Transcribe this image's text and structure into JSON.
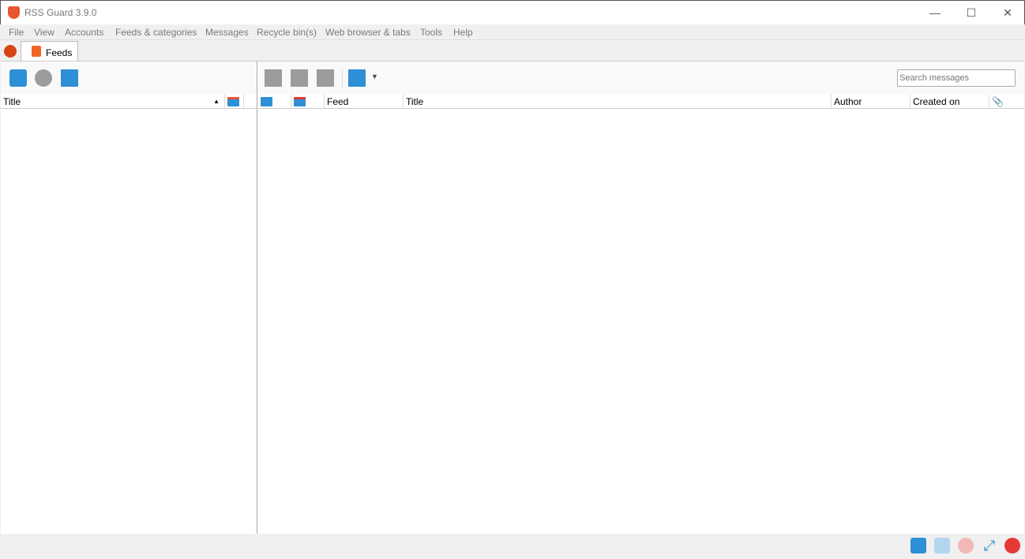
{
  "window": {
    "title": "RSS Guard 3.9.0",
    "minimize": "—",
    "maximize": "☐",
    "close": "✕"
  },
  "menu": [
    "File",
    "View",
    "Accounts",
    "Feeds & categories",
    "Messages",
    "Recycle bin(s)",
    "Web browser & tabs",
    "Tools",
    "Help"
  ],
  "tabs": [
    {
      "label": "Feeds",
      "icon": "rss-icon"
    }
  ],
  "feeds_pane": {
    "toolbar": [
      "update-feeds-icon",
      "stop-icon",
      "mark-read-icon"
    ],
    "columns": {
      "title": "Title"
    }
  },
  "messages_pane": {
    "toolbar": [
      "mark-read-icon",
      "mark-starred-icon",
      "mark-important-icon",
      "mark-dropdown-icon"
    ],
    "search_placeholder": "Search messages",
    "columns": {
      "feed": "Feed",
      "title": "Title",
      "author": "Author",
      "created_on": "Created on"
    }
  },
  "statusbar": [
    "update-all-icon",
    "update-selected-icon",
    "stop-icon",
    "fullscreen-icon",
    "quit-icon"
  ],
  "colors": {
    "accent": "#2d8fd5",
    "brand": "#e8542f",
    "danger": "#e53935"
  }
}
